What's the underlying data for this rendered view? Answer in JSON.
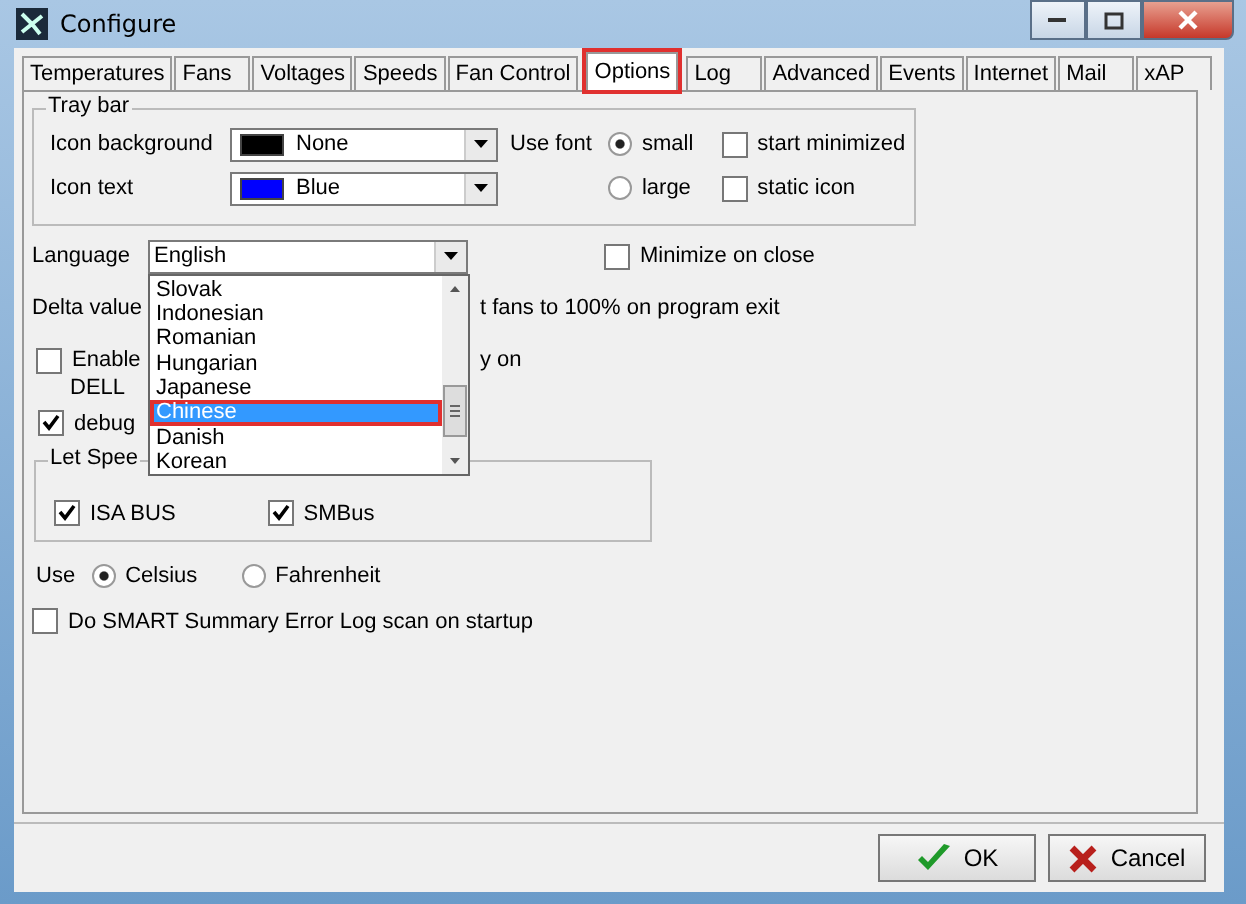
{
  "window": {
    "title": "Configure"
  },
  "tabs": [
    {
      "label": "Temperatures",
      "selected": false,
      "highlighted": false
    },
    {
      "label": "Fans",
      "selected": false,
      "highlighted": false
    },
    {
      "label": "Voltages",
      "selected": false,
      "highlighted": false
    },
    {
      "label": "Speeds",
      "selected": false,
      "highlighted": false
    },
    {
      "label": "Fan Control",
      "selected": false,
      "highlighted": false
    },
    {
      "label": "Options",
      "selected": true,
      "highlighted": true
    },
    {
      "label": "Log",
      "selected": false,
      "highlighted": false
    },
    {
      "label": "Advanced",
      "selected": false,
      "highlighted": false
    },
    {
      "label": "Events",
      "selected": false,
      "highlighted": false
    },
    {
      "label": "Internet",
      "selected": false,
      "highlighted": false
    },
    {
      "label": "Mail",
      "selected": false,
      "highlighted": false
    },
    {
      "label": "xAP",
      "selected": false,
      "highlighted": false
    }
  ],
  "tray_bar": {
    "title": "Tray bar",
    "colors": [
      {
        "label": "Icon background",
        "value": "None",
        "color": "#000000"
      },
      {
        "label": "Icon text",
        "value": "Blue",
        "color": "#0000ff"
      }
    ],
    "font_label": "Use font",
    "font_options": [
      {
        "label": "small",
        "selected": true
      },
      {
        "label": "large",
        "selected": false
      }
    ],
    "options": [
      {
        "label": "start minimized",
        "checked": false
      },
      {
        "label": "static icon",
        "checked": false
      }
    ]
  },
  "language": {
    "label": "Language",
    "value": "English",
    "list": [
      {
        "label": "Slovak",
        "selected": false,
        "highlighted": false
      },
      {
        "label": "Indonesian",
        "selected": false,
        "highlighted": false
      },
      {
        "label": "Romanian",
        "selected": false,
        "highlighted": false
      },
      {
        "label": "Hungarian",
        "selected": false,
        "highlighted": false
      },
      {
        "label": "Japanese",
        "selected": false,
        "highlighted": false
      },
      {
        "label": "Chinese",
        "selected": true,
        "highlighted": true
      },
      {
        "label": "Danish",
        "selected": false,
        "highlighted": false
      },
      {
        "label": "Korean",
        "selected": false,
        "highlighted": false
      }
    ]
  },
  "minimize_on_close": {
    "label": "Minimize on close",
    "checked": false
  },
  "delta_row": {
    "label": "Delta value",
    "text_2": "t fans to 100% on program exit"
  },
  "enable_option": {
    "checked": false,
    "label": "Enable",
    "text_2": "y on",
    "line_2": "DELL"
  },
  "debug_option": {
    "checked": true,
    "label": "debug"
  },
  "let_speed": {
    "title": "Let Spee",
    "options": [
      {
        "label": "ISA BUS",
        "checked": true
      },
      {
        "label": "SMBus",
        "checked": true
      }
    ]
  },
  "units": {
    "label": "Use",
    "options": [
      {
        "label": "Celsius",
        "selected": true
      },
      {
        "label": "Fahrenheit",
        "selected": false
      }
    ]
  },
  "smart_scan": {
    "label": "Do SMART Summary Error Log scan on startup",
    "checked": false
  },
  "buttons": [
    {
      "label": "OK",
      "kind": "ok"
    },
    {
      "label": "Cancel",
      "kind": "cancel"
    }
  ]
}
